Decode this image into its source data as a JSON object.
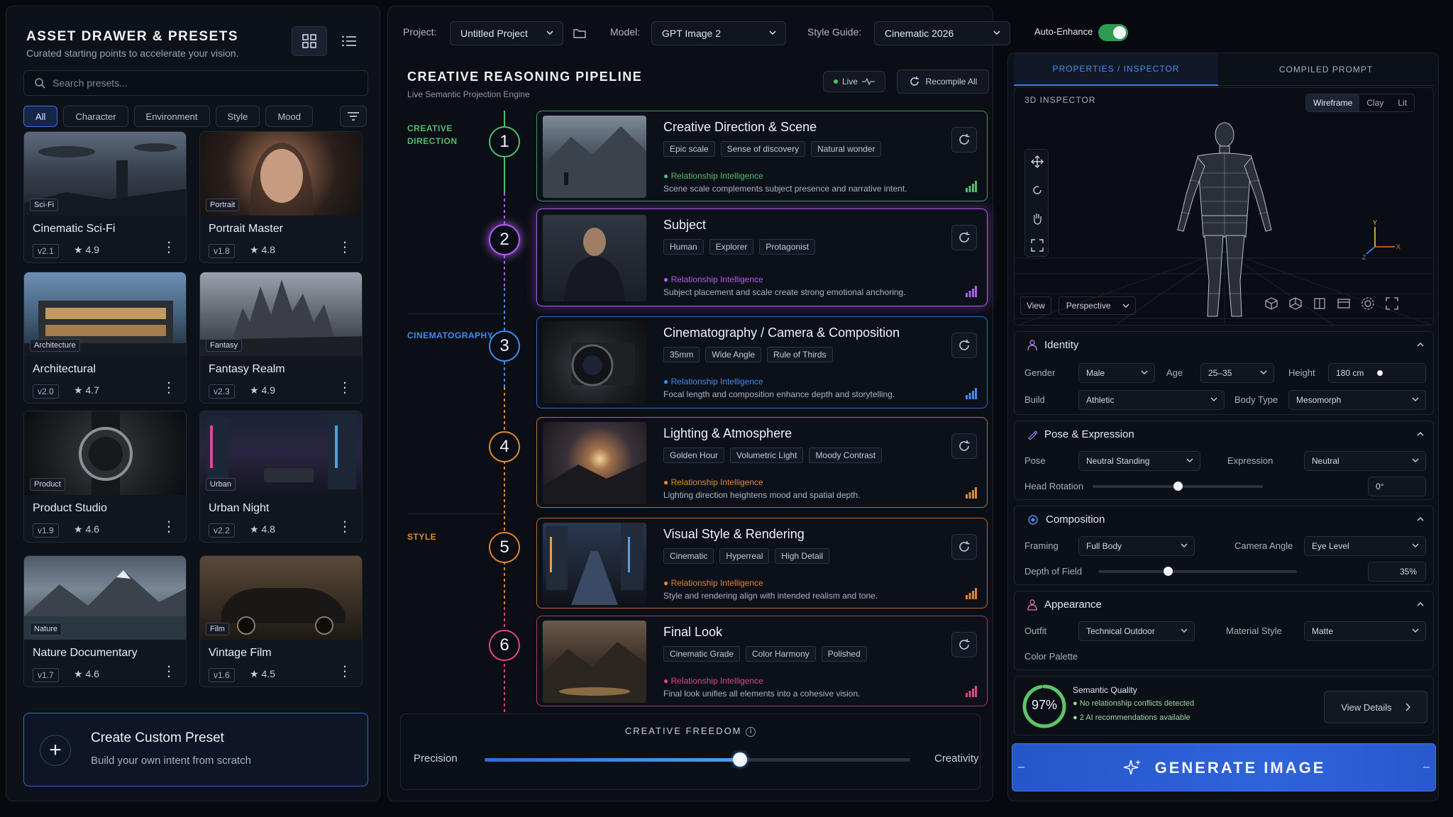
{
  "left": {
    "title": "ASSET DRAWER & PRESETS",
    "subtitle": "Curated starting points to accelerate your vision.",
    "search_placeholder": "Search presets...",
    "filters": [
      "All",
      "Character",
      "Environment",
      "Style",
      "Mood"
    ],
    "cards": [
      {
        "badge": "Sci-Fi",
        "name": "Cinematic Sci-Fi",
        "version": "v2.1",
        "rating": "★ 4.9"
      },
      {
        "badge": "Portrait",
        "name": "Portrait Master",
        "version": "v1.8",
        "rating": "★ 4.8"
      },
      {
        "badge": "Architecture",
        "name": "Architectural",
        "version": "v2.0",
        "rating": "★ 4.7"
      },
      {
        "badge": "Fantasy",
        "name": "Fantasy Realm",
        "version": "v2.3",
        "rating": "★ 4.9"
      },
      {
        "badge": "Product",
        "name": "Product Studio",
        "version": "v1.9",
        "rating": "★ 4.6"
      },
      {
        "badge": "Urban",
        "name": "Urban Night",
        "version": "v2.2",
        "rating": "★ 4.8"
      },
      {
        "badge": "Nature",
        "name": "Nature Documentary",
        "version": "v1.7",
        "rating": "★ 4.6"
      },
      {
        "badge": "Film",
        "name": "Vintage Film",
        "version": "v1.6",
        "rating": "★ 4.5"
      }
    ],
    "create_title": "Create Custom Preset",
    "create_sub": "Build your own intent from scratch"
  },
  "topbar": {
    "project_label": "Project:",
    "project": "Untitled Project",
    "model_label": "Model:",
    "model": "GPT Image 2",
    "style_label": "Style Guide:",
    "style": "Cinematic 2026",
    "auto_label": "Auto-Enhance",
    "auto_on": true
  },
  "center": {
    "title": "CREATIVE REASONING PIPELINE",
    "subtitle": "Live Semantic Projection Engine",
    "live": "Live",
    "recompile": "Recompile All",
    "stages": {
      "creative": "CREATIVE\nDIRECTION",
      "cinema": "CINEMATOGRAPHY",
      "style": "STYLE"
    },
    "ri_label": "Relationship Intelligence",
    "steps": [
      {
        "n": "1",
        "title": "Creative Direction & Scene",
        "tags": [
          "Epic scale",
          "Sense of discovery",
          "Natural wonder"
        ],
        "desc": "Scene scale complements subject presence and narrative intent.",
        "color": "#4cbf6a"
      },
      {
        "n": "2",
        "title": "Subject",
        "tags": [
          "Human",
          "Explorer",
          "Protagonist"
        ],
        "desc": "Subject placement and scale create strong emotional anchoring.",
        "color": "#b05cf0"
      },
      {
        "n": "3",
        "title": "Cinematography / Camera & Composition",
        "tags": [
          "35mm",
          "Wide Angle",
          "Rule of Thirds"
        ],
        "desc": "Focal length and composition enhance depth and storytelling.",
        "color": "#3d8cf0"
      },
      {
        "n": "4",
        "title": "Lighting & Atmosphere",
        "tags": [
          "Golden Hour",
          "Volumetric Light",
          "Moody Contrast"
        ],
        "desc": "Lighting direction heightens mood and spatial depth.",
        "color": "#e08a2e"
      },
      {
        "n": "5",
        "title": "Visual Style & Rendering",
        "tags": [
          "Cinematic",
          "Hyperreal",
          "High Detail"
        ],
        "desc": "Style and rendering align with intended realism and tone.",
        "color": "#e5822a"
      },
      {
        "n": "6",
        "title": "Final Look",
        "tags": [
          "Cinematic Grade",
          "Color Harmony",
          "Polished"
        ],
        "desc": "Final look unifies all elements into a cohesive vision.",
        "color": "#e0477a"
      }
    ],
    "freedom_title": "CREATIVE FREEDOM",
    "precision": "Precision",
    "creativity": "Creativity",
    "freedom_value": 0.6
  },
  "right": {
    "tab1": "PROPERTIES / INSPECTOR",
    "tab2": "COMPILED PROMPT",
    "inspector_title": "3D INSPECTOR",
    "modes": [
      "Wireframe",
      "Clay",
      "Lit"
    ],
    "view_label": "View",
    "view": "Perspective",
    "identity": {
      "title": "Identity",
      "gender_l": "Gender",
      "gender": "Male",
      "age_l": "Age",
      "age": "25–35",
      "height_l": "Height",
      "height": "180 cm",
      "build_l": "Build",
      "build": "Athletic",
      "body_l": "Body Type",
      "body": "Mesomorph"
    },
    "pose": {
      "title": "Pose & Expression",
      "pose_l": "Pose",
      "pose": "Neutral Standing",
      "expr_l": "Expression",
      "expr": "Neutral",
      "head_l": "Head Rotation",
      "head": "0°",
      "head_value": 0.5
    },
    "comp": {
      "title": "Composition",
      "framing_l": "Framing",
      "framing": "Full Body",
      "angle_l": "Camera Angle",
      "angle": "Eye Level",
      "dof_l": "Depth of Field",
      "dof": "35%",
      "dof_value": 0.35
    },
    "appear": {
      "title": "Appearance",
      "outfit_l": "Outfit",
      "outfit": "Technical Outdoor",
      "material_l": "Material Style",
      "material": "Matte",
      "palette_l": "Color Palette",
      "palette": [
        "#2a2f38",
        "#3e4a3a",
        "#5a3a2e",
        "#8a8d92",
        "#3a3d42"
      ]
    },
    "quality": {
      "pct": "97%",
      "title": "Semantic Quality",
      "l1": "No relationship conflicts detected",
      "l2": "2 AI recommendations available",
      "details": "View Details"
    },
    "generate": "GENERATE IMAGE"
  }
}
